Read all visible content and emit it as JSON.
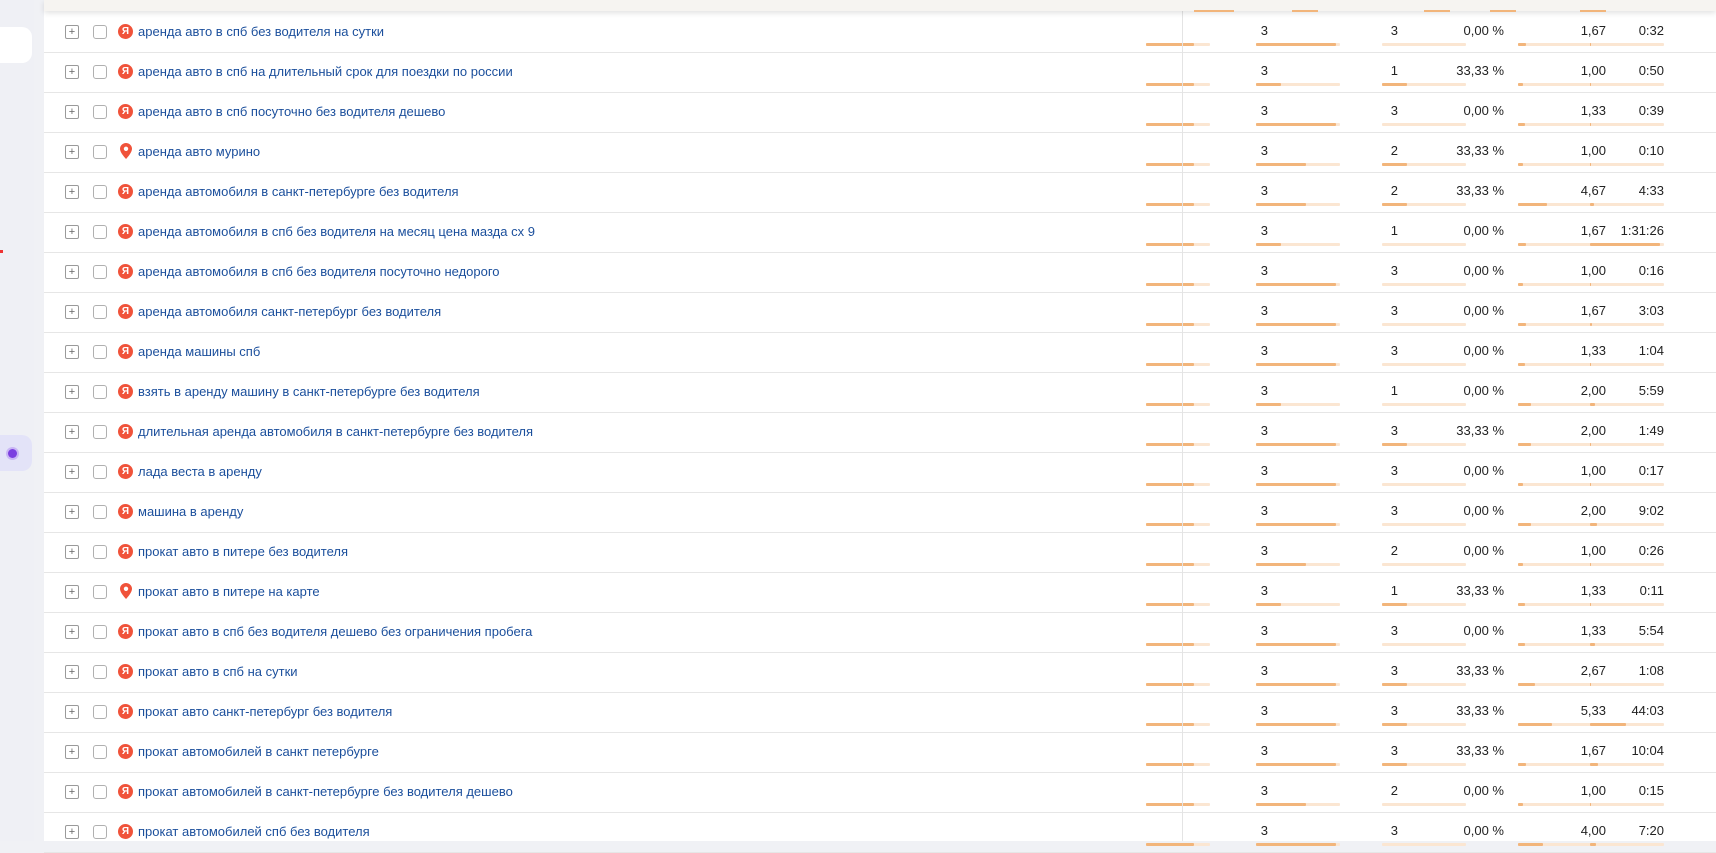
{
  "colors": {
    "bar_fill": "#f2b57b",
    "bar_track": "#fbe6d2",
    "link": "#1b4f9c",
    "yandex_icon": "#f0533a"
  },
  "icons": {
    "expand": "plus-square",
    "yandex": "Я",
    "map": "map-pin"
  },
  "table": {
    "rows": [
      {
        "icon": "yandex",
        "phrase": "аренда авто в спб без водителя на сутки",
        "visits": "3",
        "users": "3",
        "bounce": "0,00 %",
        "depth": "1,67",
        "time": "0:32",
        "visits_level": 0.75,
        "users_level": 0.95,
        "bounce_level": 0.0,
        "depth_level": 0.1,
        "time_level": 0.02
      },
      {
        "icon": "yandex",
        "phrase": "аренда авто в спб на длительный срок для поездки по россии",
        "visits": "3",
        "users": "1",
        "bounce": "33,33 %",
        "depth": "1,00",
        "time": "0:50",
        "visits_level": 0.75,
        "users_level": 0.3,
        "bounce_level": 0.3,
        "depth_level": 0.06,
        "time_level": 0.02
      },
      {
        "icon": "yandex",
        "phrase": "аренда авто в спб посуточно без водителя дешево",
        "visits": "3",
        "users": "3",
        "bounce": "0,00 %",
        "depth": "1,33",
        "time": "0:39",
        "visits_level": 0.75,
        "users_level": 0.95,
        "bounce_level": 0.0,
        "depth_level": 0.08,
        "time_level": 0.02
      },
      {
        "icon": "map",
        "phrase": "аренда авто мурино",
        "visits": "3",
        "users": "2",
        "bounce": "33,33 %",
        "depth": "1,00",
        "time": "0:10",
        "visits_level": 0.75,
        "users_level": 0.6,
        "bounce_level": 0.3,
        "depth_level": 0.06,
        "time_level": 0.01
      },
      {
        "icon": "yandex",
        "phrase": "аренда автомобиля в санкт-петербурге без водителя",
        "visits": "3",
        "users": "2",
        "bounce": "33,33 %",
        "depth": "4,67",
        "time": "4:33",
        "visits_level": 0.75,
        "users_level": 0.6,
        "bounce_level": 0.3,
        "depth_level": 0.35,
        "time_level": 0.05
      },
      {
        "icon": "yandex",
        "phrase": "аренда автомобиля в спб без водителя на месяц цена мазда сх 9",
        "visits": "3",
        "users": "1",
        "bounce": "0,00 %",
        "depth": "1,67",
        "time": "1:31:26",
        "visits_level": 0.75,
        "users_level": 0.3,
        "bounce_level": 0.0,
        "depth_level": 0.1,
        "time_level": 0.95
      },
      {
        "icon": "yandex",
        "phrase": "аренда автомобиля в спб без водителя посуточно недорого",
        "visits": "3",
        "users": "3",
        "bounce": "0,00 %",
        "depth": "1,00",
        "time": "0:16",
        "visits_level": 0.75,
        "users_level": 0.95,
        "bounce_level": 0.0,
        "depth_level": 0.06,
        "time_level": 0.01
      },
      {
        "icon": "yandex",
        "phrase": "аренда автомобиля санкт-петербург без водителя",
        "visits": "3",
        "users": "3",
        "bounce": "0,00 %",
        "depth": "1,67",
        "time": "3:03",
        "visits_level": 0.75,
        "users_level": 0.95,
        "bounce_level": 0.0,
        "depth_level": 0.1,
        "time_level": 0.03
      },
      {
        "icon": "yandex",
        "phrase": "аренда машины спб",
        "visits": "3",
        "users": "3",
        "bounce": "0,00 %",
        "depth": "1,33",
        "time": "1:04",
        "visits_level": 0.75,
        "users_level": 0.95,
        "bounce_level": 0.0,
        "depth_level": 0.08,
        "time_level": 0.02
      },
      {
        "icon": "yandex",
        "phrase": "взять в аренду машину в санкт-петербурге без водителя",
        "visits": "3",
        "users": "1",
        "bounce": "0,00 %",
        "depth": "2,00",
        "time": "5:59",
        "visits_level": 0.75,
        "users_level": 0.3,
        "bounce_level": 0.0,
        "depth_level": 0.15,
        "time_level": 0.07
      },
      {
        "icon": "yandex",
        "phrase": "длительная аренда автомобиля в санкт-петербурге без водителя",
        "visits": "3",
        "users": "3",
        "bounce": "33,33 %",
        "depth": "2,00",
        "time": "1:49",
        "visits_level": 0.75,
        "users_level": 0.95,
        "bounce_level": 0.3,
        "depth_level": 0.15,
        "time_level": 0.02
      },
      {
        "icon": "yandex",
        "phrase": "лада веста в аренду",
        "visits": "3",
        "users": "3",
        "bounce": "0,00 %",
        "depth": "1,00",
        "time": "0:17",
        "visits_level": 0.75,
        "users_level": 0.95,
        "bounce_level": 0.0,
        "depth_level": 0.06,
        "time_level": 0.01
      },
      {
        "icon": "yandex",
        "phrase": "машина в аренду",
        "visits": "3",
        "users": "3",
        "bounce": "0,00 %",
        "depth": "2,00",
        "time": "9:02",
        "visits_level": 0.75,
        "users_level": 0.95,
        "bounce_level": 0.0,
        "depth_level": 0.15,
        "time_level": 0.1
      },
      {
        "icon": "yandex",
        "phrase": "прокат авто в питере без водителя",
        "visits": "3",
        "users": "2",
        "bounce": "0,00 %",
        "depth": "1,00",
        "time": "0:26",
        "visits_level": 0.75,
        "users_level": 0.6,
        "bounce_level": 0.0,
        "depth_level": 0.06,
        "time_level": 0.01
      },
      {
        "icon": "map",
        "phrase": "прокат авто в питере на карте",
        "visits": "3",
        "users": "1",
        "bounce": "33,33 %",
        "depth": "1,33",
        "time": "0:11",
        "visits_level": 0.75,
        "users_level": 0.3,
        "bounce_level": 0.3,
        "depth_level": 0.08,
        "time_level": 0.01
      },
      {
        "icon": "yandex",
        "phrase": "прокат авто в спб без водителя дешево без ограничения пробега",
        "visits": "3",
        "users": "3",
        "bounce": "0,00 %",
        "depth": "1,33",
        "time": "5:54",
        "visits_level": 0.75,
        "users_level": 0.95,
        "bounce_level": 0.0,
        "depth_level": 0.08,
        "time_level": 0.07
      },
      {
        "icon": "yandex",
        "phrase": "прокат авто в спб на сутки",
        "visits": "3",
        "users": "3",
        "bounce": "33,33 %",
        "depth": "2,67",
        "time": "1:08",
        "visits_level": 0.75,
        "users_level": 0.95,
        "bounce_level": 0.3,
        "depth_level": 0.2,
        "time_level": 0.02
      },
      {
        "icon": "yandex",
        "phrase": "прокат авто санкт-петербург без водителя",
        "visits": "3",
        "users": "3",
        "bounce": "33,33 %",
        "depth": "5,33",
        "time": "44:03",
        "visits_level": 0.75,
        "users_level": 0.95,
        "bounce_level": 0.3,
        "depth_level": 0.4,
        "time_level": 0.48
      },
      {
        "icon": "yandex",
        "phrase": "прокат автомобилей в санкт петербурге",
        "visits": "3",
        "users": "3",
        "bounce": "33,33 %",
        "depth": "1,67",
        "time": "10:04",
        "visits_level": 0.75,
        "users_level": 0.95,
        "bounce_level": 0.3,
        "depth_level": 0.1,
        "time_level": 0.11
      },
      {
        "icon": "yandex",
        "phrase": "прокат автомобилей в санкт-петербурге без водителя дешево",
        "visits": "3",
        "users": "2",
        "bounce": "0,00 %",
        "depth": "1,00",
        "time": "0:15",
        "visits_level": 0.75,
        "users_level": 0.6,
        "bounce_level": 0.0,
        "depth_level": 0.06,
        "time_level": 0.01
      },
      {
        "icon": "yandex",
        "phrase": "прокат автомобилей спб без водителя",
        "visits": "3",
        "users": "3",
        "bounce": "0,00 %",
        "depth": "4,00",
        "time": "7:20",
        "visits_level": 0.75,
        "users_level": 0.95,
        "bounce_level": 0.0,
        "depth_level": 0.3,
        "time_level": 0.08
      }
    ]
  }
}
